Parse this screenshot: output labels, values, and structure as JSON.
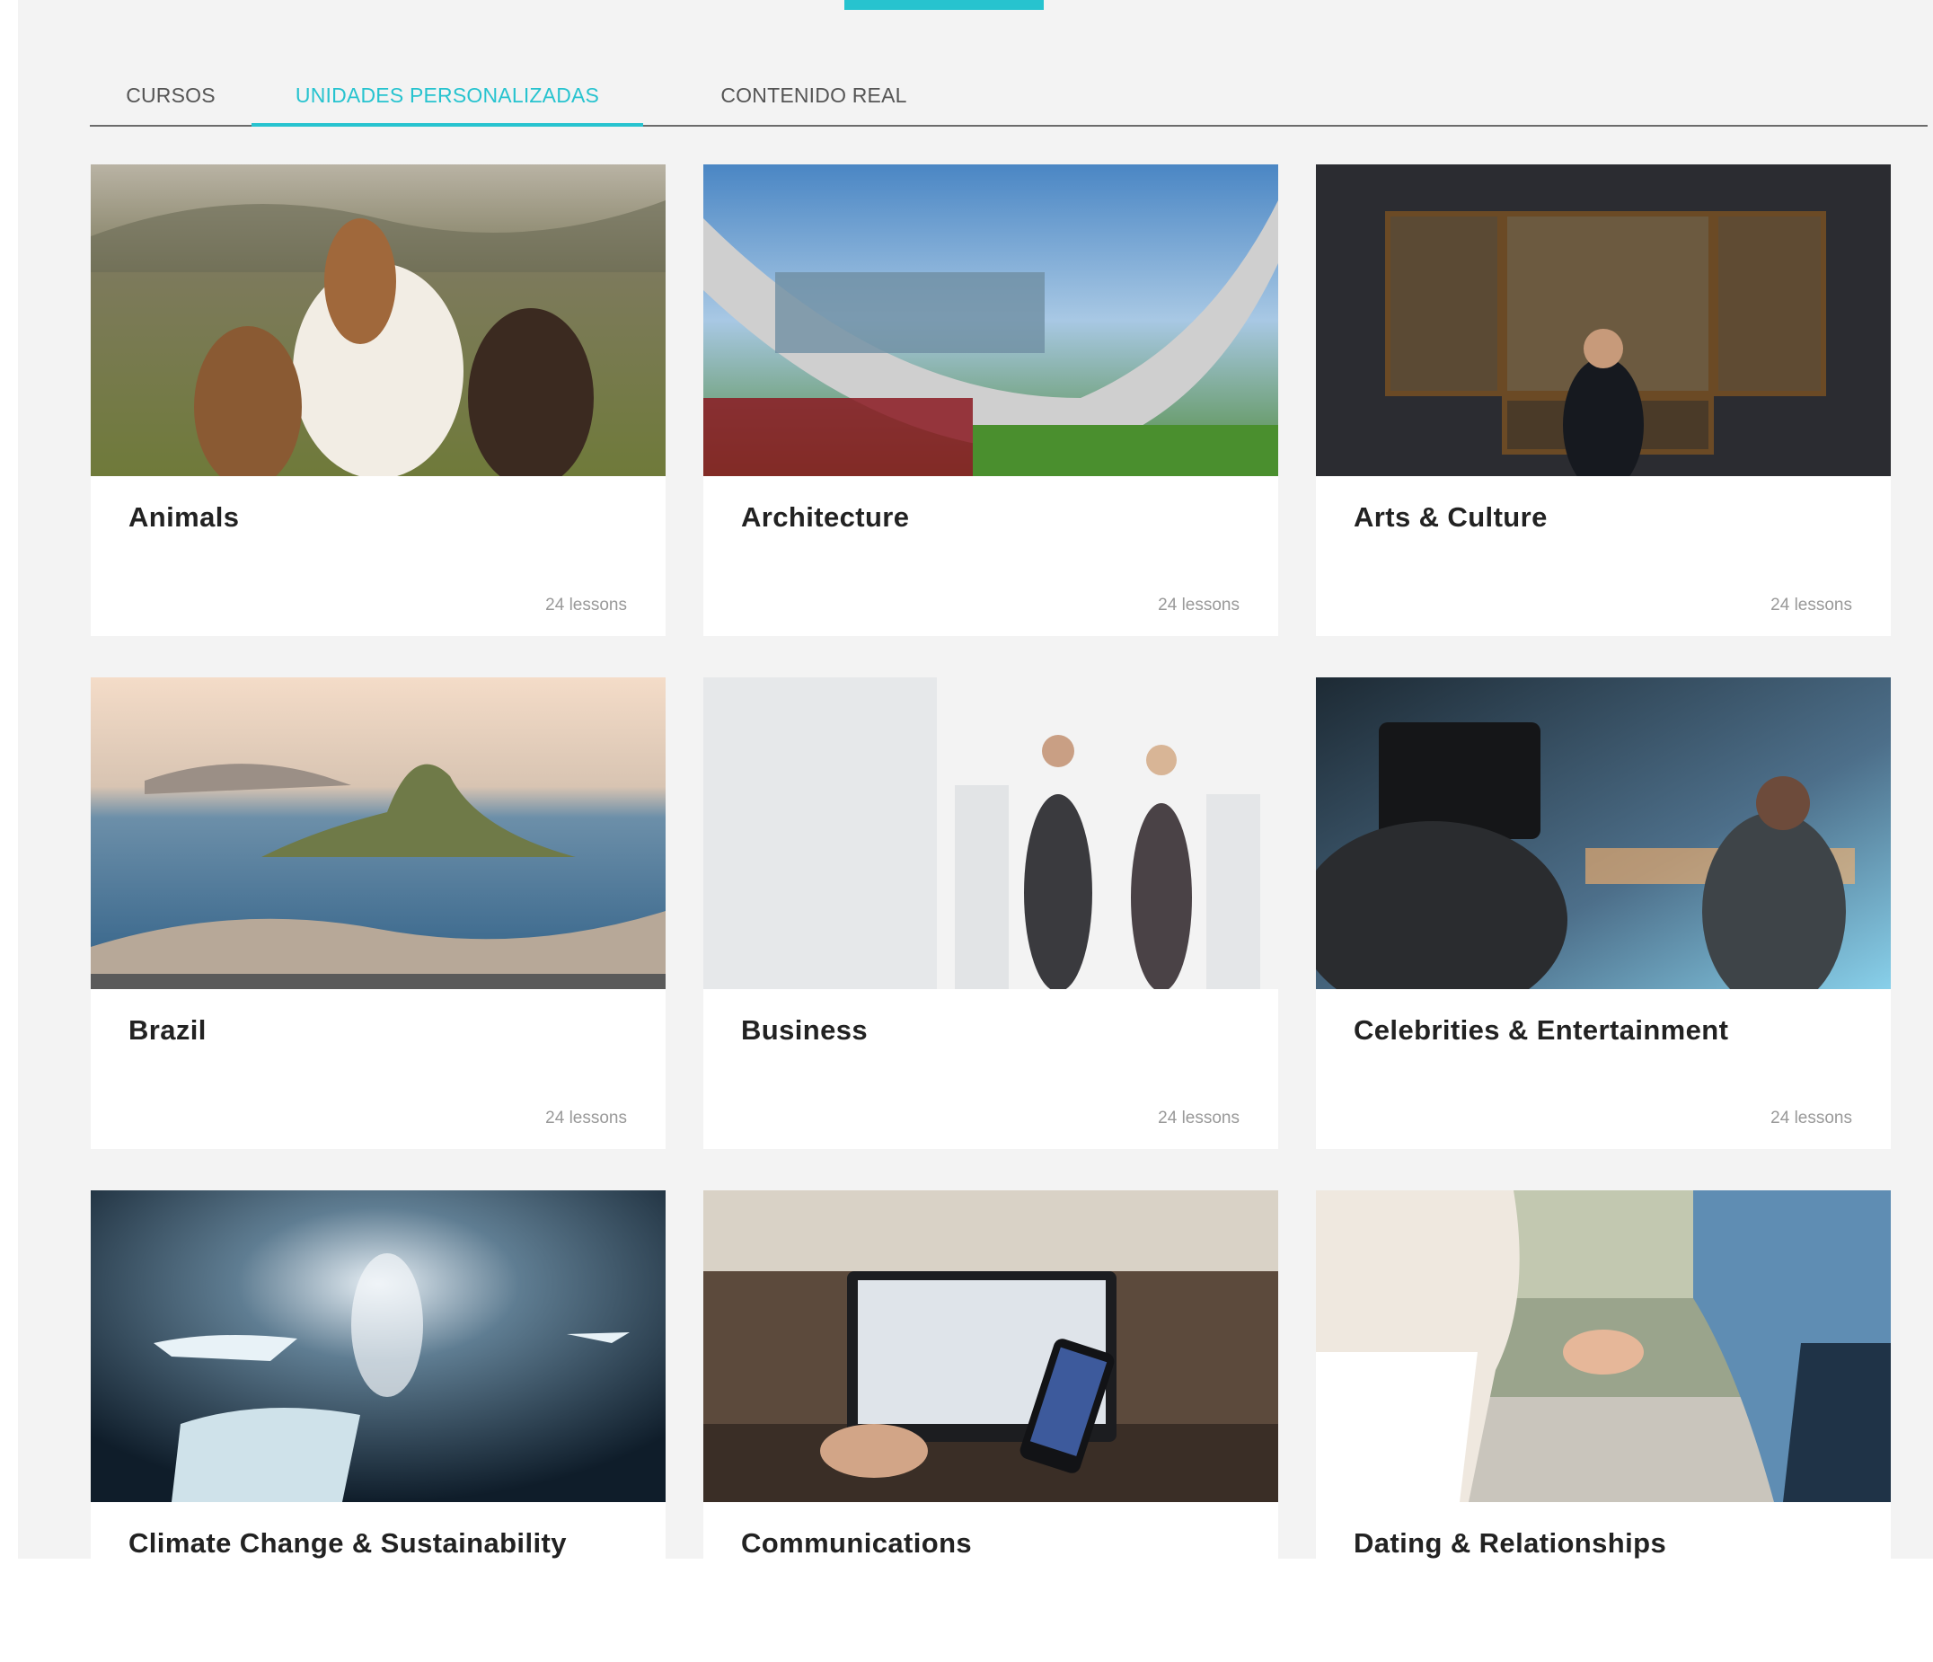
{
  "tabs": [
    {
      "label": "CURSOS",
      "active": false
    },
    {
      "label": "UNIDADES PERSONALIZADAS",
      "active": true
    },
    {
      "label": "CONTENIDO REAL",
      "active": false
    }
  ],
  "accent_color": "#27c3cf",
  "cards": [
    {
      "title": "Animals",
      "count": "24 lessons"
    },
    {
      "title": "Architecture",
      "count": "24 lessons"
    },
    {
      "title": "Arts & Culture",
      "count": "24 lessons"
    },
    {
      "title": "Brazil",
      "count": "24 lessons"
    },
    {
      "title": "Business",
      "count": "24 lessons"
    },
    {
      "title": "Celebrities & Entertainment",
      "count": "24 lessons"
    },
    {
      "title": "Climate Change & Sustainability",
      "count": ""
    },
    {
      "title": "Communications",
      "count": ""
    },
    {
      "title": "Dating & Relationships",
      "count": ""
    }
  ]
}
